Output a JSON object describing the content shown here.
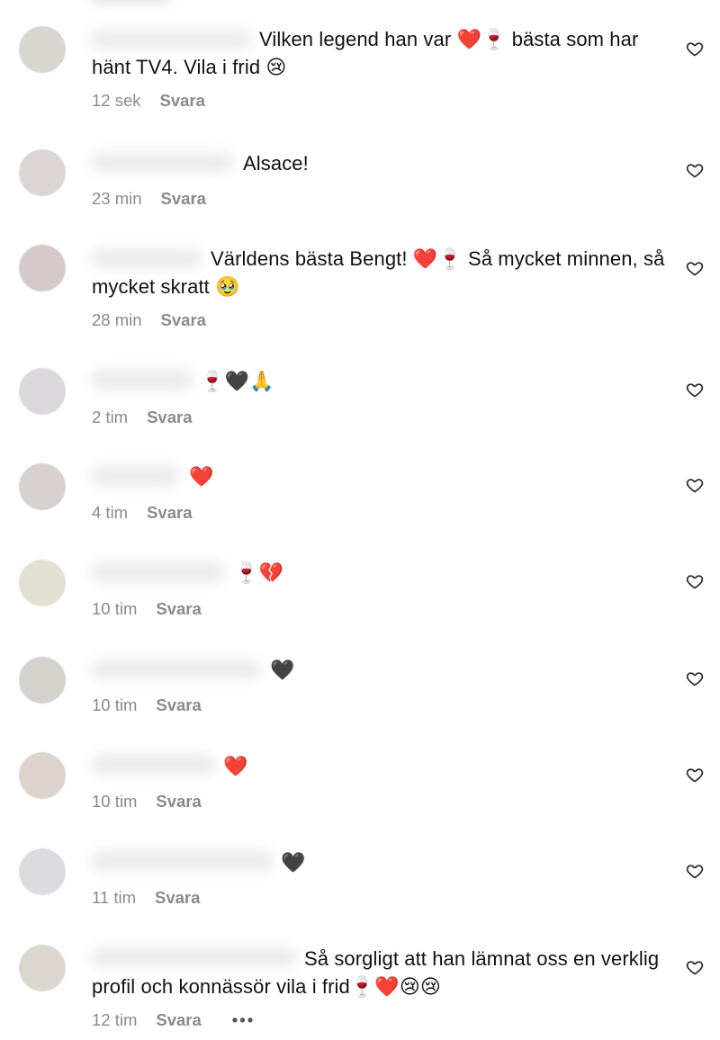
{
  "comments": [
    {
      "text": "Vilken legend han var ❤️🍷 bästa som har hänt TV4. Vila i frid 😢",
      "time": "12 sek",
      "reply_label": "Svara",
      "avatar_color": "#d9d6cf",
      "indent": "                               "
    },
    {
      "text": "Alsace!",
      "time": "23 min",
      "reply_label": "Svara",
      "avatar_color": "#dcd5d6",
      "indent": "                          "
    },
    {
      "text": "Världens bästa Bengt! ❤️🍷 Så mycket minnen, så mycket skratt 🥹",
      "time": "28 min",
      "reply_label": "Svara",
      "avatar_color": "#d6c9c9",
      "indent": "                         "
    },
    {
      "text": "🍷🖤🙏",
      "time": "2 tim",
      "reply_label": "Svara",
      "avatar_color": "#dbd8db",
      "indent": "                   "
    },
    {
      "text": "❤️",
      "time": "4 tim",
      "reply_label": "Svara",
      "avatar_color": "#d8d1d2",
      "indent": "                 "
    },
    {
      "text": "🍷💔",
      "time": "10 tim",
      "reply_label": "Svara",
      "avatar_color": "#e2dfd3",
      "indent": "                              "
    },
    {
      "text": "🖤",
      "time": "10 tim",
      "reply_label": "Svara",
      "avatar_color": "#d3d2cd",
      "indent": "                                     "
    },
    {
      "text": "❤️",
      "time": "10 tim",
      "reply_label": "Svara",
      "avatar_color": "#dcd3cf",
      "indent": "                              "
    },
    {
      "text": "🖤",
      "time": "11 tim",
      "reply_label": "Svara",
      "avatar_color": "#dcdce0",
      "indent": "                                       "
    },
    {
      "text": "Så sorgligt att han lämnat oss en verklig profil och konnässör vila i frid🍷❤️😢😢",
      "time": "12 tim",
      "reply_label": "Svara",
      "avatar_color": "#dcd6d0",
      "more_label": "•••",
      "indent": "                                       "
    }
  ],
  "like_icon": "heart-outline-icon"
}
